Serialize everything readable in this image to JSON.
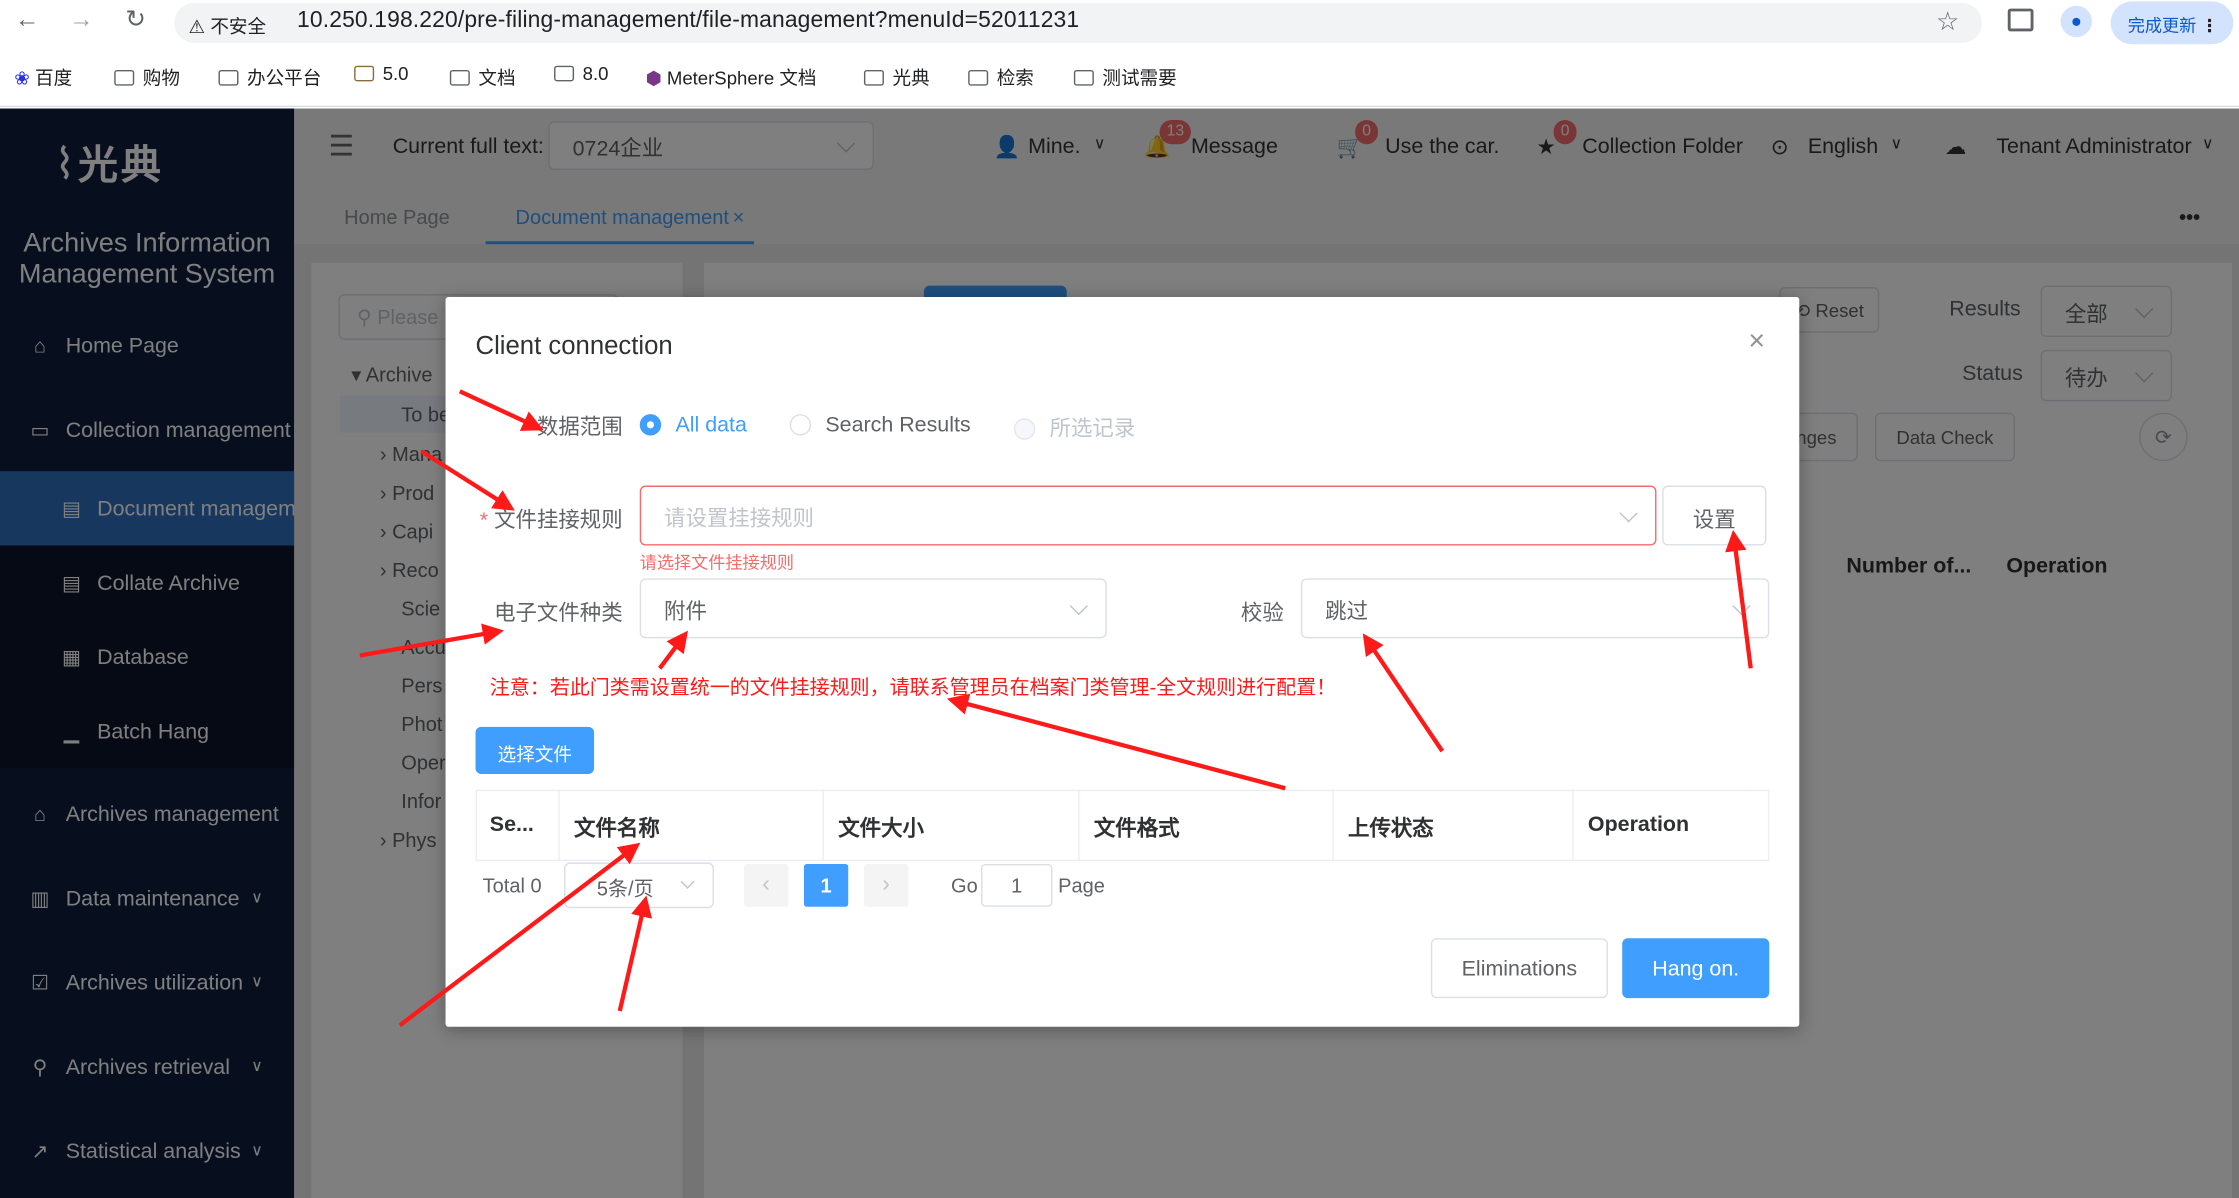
{
  "browser": {
    "back": "←",
    "forward": "→",
    "reload": "↻",
    "security": "不安全",
    "url": "10.250.198.220/pre-filing-management/file-management?menuId=52011231",
    "update_label": "完成更新",
    "bookmarks": [
      "百度",
      "购物",
      "办公平台",
      "5.0",
      "文档",
      "8.0",
      "MeterSphere 文档",
      "光典",
      "检索",
      "测试需要"
    ]
  },
  "sidebar": {
    "logo": "光典",
    "system_name_line1": "Archives Information",
    "system_name_line2": "Management System",
    "items": [
      {
        "label": "Home Page",
        "icon": "home-icon"
      },
      {
        "label": "Collection management",
        "icon": "box-icon"
      },
      {
        "label": "Document managem",
        "icon": "document-icon"
      },
      {
        "label": "Collate Archive",
        "icon": "file-icon"
      },
      {
        "label": "Database",
        "icon": "calendar-icon"
      },
      {
        "label": "Batch Hang",
        "icon": "chart-icon"
      },
      {
        "label": "Archives management",
        "icon": "bank-icon"
      },
      {
        "label": "Data maintenance",
        "icon": "building-icon"
      },
      {
        "label": "Archives utilization",
        "icon": "checklist-icon"
      },
      {
        "label": "Archives retrieval",
        "icon": "search-icon"
      },
      {
        "label": "Statistical analysis",
        "icon": "line-chart-icon"
      }
    ]
  },
  "topbar": {
    "current_label": "Current full text:",
    "current_value": "0724企业",
    "mine": "Mine.",
    "message": "Message",
    "message_count": "13",
    "cart": "Use the car.",
    "cart_count": "0",
    "collection": "Collection Folder",
    "collection_count": "0",
    "language": "English",
    "tenant": "Tenant Administrator"
  },
  "tabs": {
    "home": "Home Page",
    "active": "Document management",
    "more": "•••"
  },
  "background": {
    "search_placeholder": "Please",
    "tree": [
      "Archive",
      "To be",
      "Mana",
      "Prod",
      "Capi",
      "Reco",
      "Scie",
      "Accu",
      "Pers",
      "Phot",
      "Oper",
      "Infor",
      "Phys"
    ],
    "reset": "Reset",
    "results_label": "Results",
    "results_value": "全部",
    "status_label": "Status",
    "status_value": "待办",
    "changes": "nges",
    "data_check": "Data Check",
    "col_number": "Number of...",
    "col_operation": "Operation"
  },
  "modal": {
    "title": "Client connection",
    "scope_label": "数据范围",
    "scope_options": [
      "All data",
      "Search Results",
      "所选记录"
    ],
    "rule_label": "文件挂接规则",
    "rule_placeholder": "请设置挂接规则",
    "rule_error": "请选择文件挂接规则",
    "settings_button": "设置",
    "type_label": "电子文件种类",
    "type_value": "附件",
    "check_label": "校验",
    "check_value": "跳过",
    "notice": "注意：若此门类需设置统一的文件挂接规则，请联系管理员在档案门类管理-全文规则进行配置！",
    "select_file": "选择文件",
    "columns": [
      "Se...",
      "文件名称",
      "文件大小",
      "文件格式",
      "上传状态",
      "Operation"
    ],
    "total": "Total 0",
    "page_size": "5条/页",
    "current_page": "1",
    "go_label": "Go",
    "go_value": "1",
    "page_label": "Page",
    "cancel": "Eliminations",
    "confirm": "Hang on."
  },
  "colors": {
    "primary": "#409eff",
    "sidebar": "#0f1f3d",
    "active_menu": "#2f6fbd",
    "error": "#f56c6c",
    "annotation": "#ff1a1a"
  }
}
